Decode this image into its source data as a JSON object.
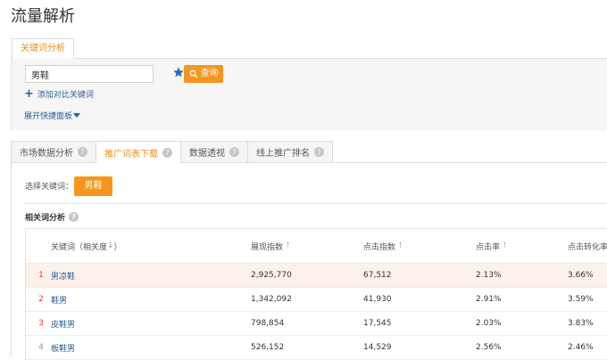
{
  "page": {
    "title": "流量解析"
  },
  "top_tab": {
    "label": "关键词分析"
  },
  "search": {
    "input_value": "男鞋",
    "query_button": "查询",
    "add_compare": "添加对比关键词",
    "expand_panel": "展开快捷面板"
  },
  "tabs": [
    {
      "label": "市场数据分析"
    },
    {
      "label": "推广词表下载"
    },
    {
      "label": "数据透视"
    },
    {
      "label": "线上推广排名"
    }
  ],
  "content": {
    "select_label": "选择关键词：",
    "selected_keyword": "男鞋",
    "section_title": "相关词分析"
  },
  "table": {
    "columns": {
      "keyword": "关键词（相关度",
      "impressions": "展现指数",
      "clicks": "点击指数",
      "ctr": "点击率",
      "cvr": "点击转化率"
    },
    "rows": [
      {
        "rank": "1",
        "keyword": "男凉鞋",
        "impressions": "2,925,770",
        "clicks": "67,512",
        "ctr": "2.13%",
        "cvr": "3.66%"
      },
      {
        "rank": "2",
        "keyword": "鞋男",
        "impressions": "1,342,092",
        "clicks": "41,930",
        "ctr": "2.91%",
        "cvr": "3.59%"
      },
      {
        "rank": "3",
        "keyword": "皮鞋男",
        "impressions": "798,854",
        "clicks": "17,545",
        "ctr": "2.03%",
        "cvr": "3.83%"
      },
      {
        "rank": "4",
        "keyword": "板鞋男",
        "impressions": "526,152",
        "clicks": "14,529",
        "ctr": "2.56%",
        "cvr": "2.46%"
      }
    ]
  },
  "colors": {
    "accent": "#f6961e",
    "link": "#2a5d9f",
    "rank_top": "#d93a2a",
    "highlight_row": "#fdf1ea"
  }
}
